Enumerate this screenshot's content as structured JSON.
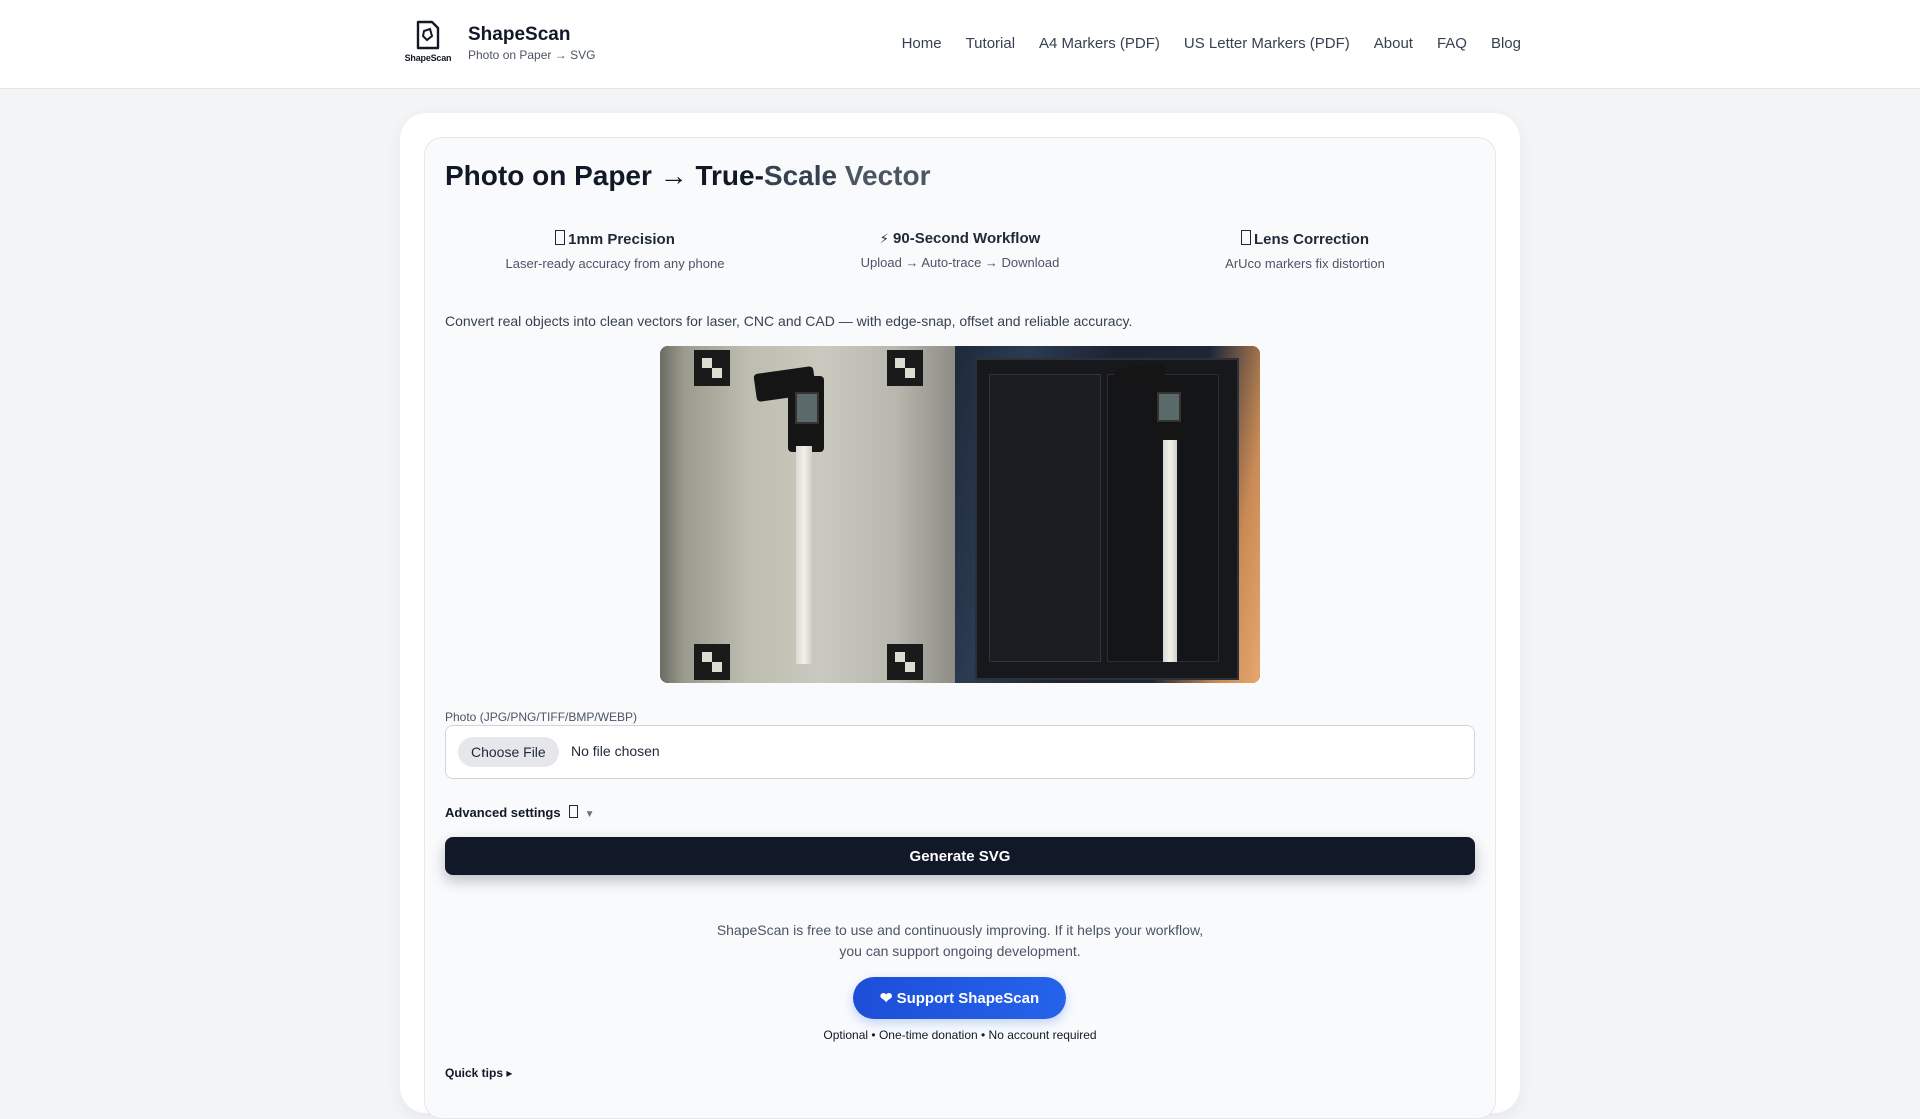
{
  "header": {
    "logo_text": "ShapeScan",
    "brand_name": "ShapeScan",
    "tagline": "Photo on Paper → SVG",
    "nav": [
      {
        "label": "Home"
      },
      {
        "label": "Tutorial"
      },
      {
        "label": "A4 Markers (PDF)"
      },
      {
        "label": "US Letter Markers (PDF)"
      },
      {
        "label": "About"
      },
      {
        "label": "FAQ"
      },
      {
        "label": "Blog"
      }
    ]
  },
  "main": {
    "title_part1": "Photo on Paper → True-",
    "title_part2": "Scale",
    "title_part3": " Vector",
    "features": [
      {
        "icon": "box-icon",
        "title": "1mm Precision",
        "desc": "Laser-ready accuracy from any phone"
      },
      {
        "icon": "lightning-icon",
        "glyph": "⚡",
        "title": "90-Second Workflow",
        "desc": "Upload → Auto-trace → Download"
      },
      {
        "icon": "box-icon",
        "title": "Lens Correction",
        "desc": "ArUco markers fix distortion"
      }
    ],
    "description": "Convert real objects into clean vectors for laser, CNC and CAD — with edge-snap, offset and reliable accuracy.",
    "upload": {
      "label": "Photo (JPG/PNG/TIFF/BMP/WEBP)",
      "button": "Choose File",
      "status": "No file chosen"
    },
    "advanced": {
      "label": "Advanced settings",
      "caret": "▼"
    },
    "generate_label": "Generate SVG",
    "support": {
      "text": "ShapeScan is free to use and continuously improving. If it helps your workflow, you can support ongoing development.",
      "button": "❤ Support ShapeScan",
      "note": "Optional • One-time donation • No account required"
    },
    "quick_tips": "Quick tips ▸"
  }
}
